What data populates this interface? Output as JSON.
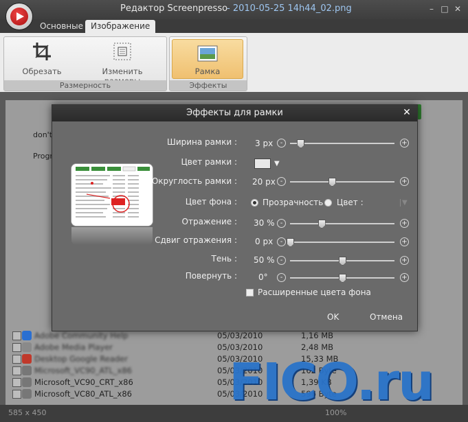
{
  "window": {
    "app_title": "Редактор Screenpresso",
    "file_name": "-  2010-05-25 14h44_02.png",
    "controls": {
      "minimize": "–",
      "maximize": "□",
      "close": "✕"
    }
  },
  "tabs": [
    {
      "label": "Основные",
      "active": false
    },
    {
      "label": "Изображение",
      "active": true
    }
  ],
  "ribbon": {
    "groups": [
      {
        "label": "Размерность",
        "buttons": [
          {
            "label": "Обрезать",
            "icon": "crop-icon"
          },
          {
            "label": "Изменить размеры",
            "icon": "resize-icon"
          }
        ]
      },
      {
        "label": "Эффекты",
        "buttons": [
          {
            "label": "Рамка",
            "icon": "frame-icon",
            "selected": true
          }
        ]
      }
    ]
  },
  "background": {
    "side_texts": [
      "don't",
      "Progr"
    ],
    "rows": [
      {
        "name": "Adobe Community Help",
        "date": "05/03/2010",
        "size": "1,16 MB",
        "blurred_name": true,
        "icon_color": "#2a6fd1"
      },
      {
        "name": "Adobe Media Player",
        "date": "05/03/2010",
        "size": "2,48 MB",
        "blurred_name": true,
        "icon_color": "#8a8a8a"
      },
      {
        "name": "Desktop Google Reader",
        "date": "05/03/2010",
        "size": "15,33 MB",
        "blurred_name": true,
        "icon_color": "#c0392b"
      },
      {
        "name": "Microsoft_VC90_ATL_x86",
        "date": "05/03/2010",
        "size": "162 Byte",
        "blurred_name": true,
        "icon_color": "#777"
      },
      {
        "name": "Microsoft_VC90_CRT_x86",
        "date": "05/03/2010",
        "size": "1,39 KB",
        "blurred_name": false,
        "icon_color": "#777"
      },
      {
        "name": "Microsoft_VC80_ATL_x86",
        "date": "05/03/2010",
        "size": "596 Byte",
        "blurred_name": false,
        "icon_color": "#777"
      }
    ]
  },
  "status": {
    "image_size": "585 x 450",
    "zoom": "100%"
  },
  "watermark": "FICO.ru",
  "dialog": {
    "title": "Эффекты для рамки",
    "close": "✕",
    "fields": {
      "frame_width": {
        "label": "Ширина рамки :",
        "value": "3 px",
        "level": 0.1
      },
      "frame_color": {
        "label": "Цвет рамки :",
        "color": "#e8e8e8"
      },
      "corner_radius": {
        "label": "Округлость рамки :",
        "value": "20 px",
        "level": 0.4
      },
      "background_color": {
        "label": "Цвет фона :",
        "option_transparent": "Прозрачность",
        "option_color": "Цвет :",
        "selected": "transparent"
      },
      "reflection": {
        "label": "Отражение :",
        "value": "30 %",
        "level": 0.3
      },
      "reflection_shift": {
        "label": "Сдвиг отражения :",
        "value": "0 px",
        "level": 0.0
      },
      "shadow": {
        "label": "Тень :",
        "value": "50 %",
        "level": 0.5
      },
      "rotate": {
        "label": "Повернуть :",
        "value": "0°",
        "level": 0.5
      }
    },
    "extended_colors": {
      "label": "Расширенные цвета фона",
      "checked": false
    },
    "ok": "OK",
    "cancel": "Отмена"
  }
}
